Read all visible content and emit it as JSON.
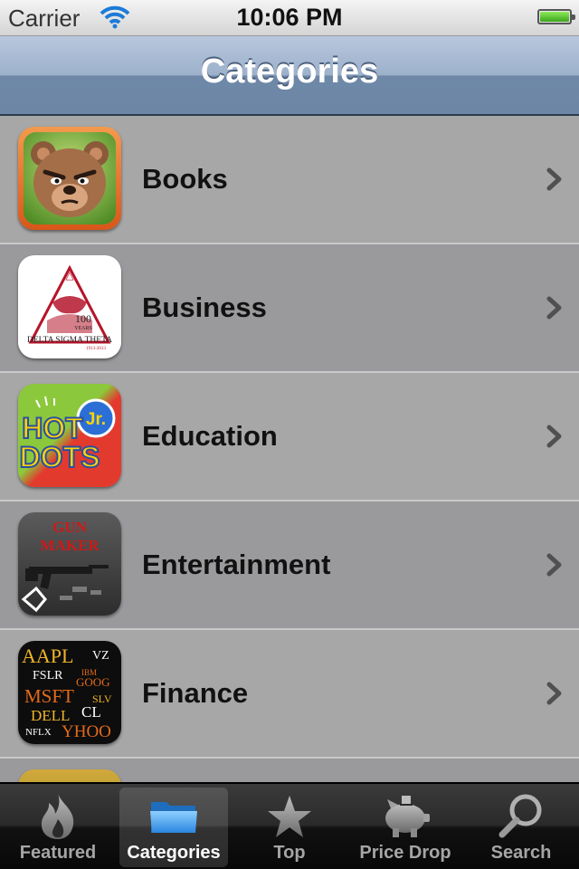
{
  "status_bar": {
    "carrier": "Carrier",
    "time": "10:06 PM"
  },
  "nav": {
    "title": "Categories"
  },
  "categories": [
    {
      "label": "Books",
      "icon": "angry-bear-app-icon"
    },
    {
      "label": "Business",
      "icon": "delta-sigma-theta-app-icon",
      "icon_text": {
        "number": "100",
        "sub": "YEARS",
        "name": "DELTA SIGMA THETA",
        "years": "1913-2013"
      }
    },
    {
      "label": "Education",
      "icon": "hot-dots-jr-app-icon",
      "icon_text": {
        "line1": "HOT",
        "line2": "DOTS",
        "badge": "Jr."
      }
    },
    {
      "label": "Entertainment",
      "icon": "gun-maker-app-icon",
      "icon_text": {
        "line1": "GUN",
        "line2": "MAKER"
      }
    },
    {
      "label": "Finance",
      "icon": "stock-tickers-app-icon",
      "icon_text": {
        "t1": "AAPL",
        "t2": "VZ",
        "t3": "FSLR",
        "t4": "IBM",
        "t5": "GOOG",
        "t6": "MSFT",
        "t7": "SLV",
        "t8": "DELL",
        "t9": "CL",
        "t10": "NFLX",
        "t11": "YHOO"
      }
    }
  ],
  "tabs": [
    {
      "label": "Featured",
      "icon": "flame-icon",
      "selected": false
    },
    {
      "label": "Categories",
      "icon": "folder-icon",
      "selected": true
    },
    {
      "label": "Top",
      "icon": "star-icon",
      "selected": false
    },
    {
      "label": "Price Drop",
      "icon": "piggy-bank-icon",
      "selected": false
    },
    {
      "label": "Search",
      "icon": "magnifier-icon",
      "selected": false
    }
  ],
  "colors": {
    "nav_bar": "#8ea3bf",
    "row_light": "#a7a7a7",
    "row_dark": "#9a9a9d",
    "tab_bar": "#1a1a1a",
    "battery": "#3aa51a"
  }
}
